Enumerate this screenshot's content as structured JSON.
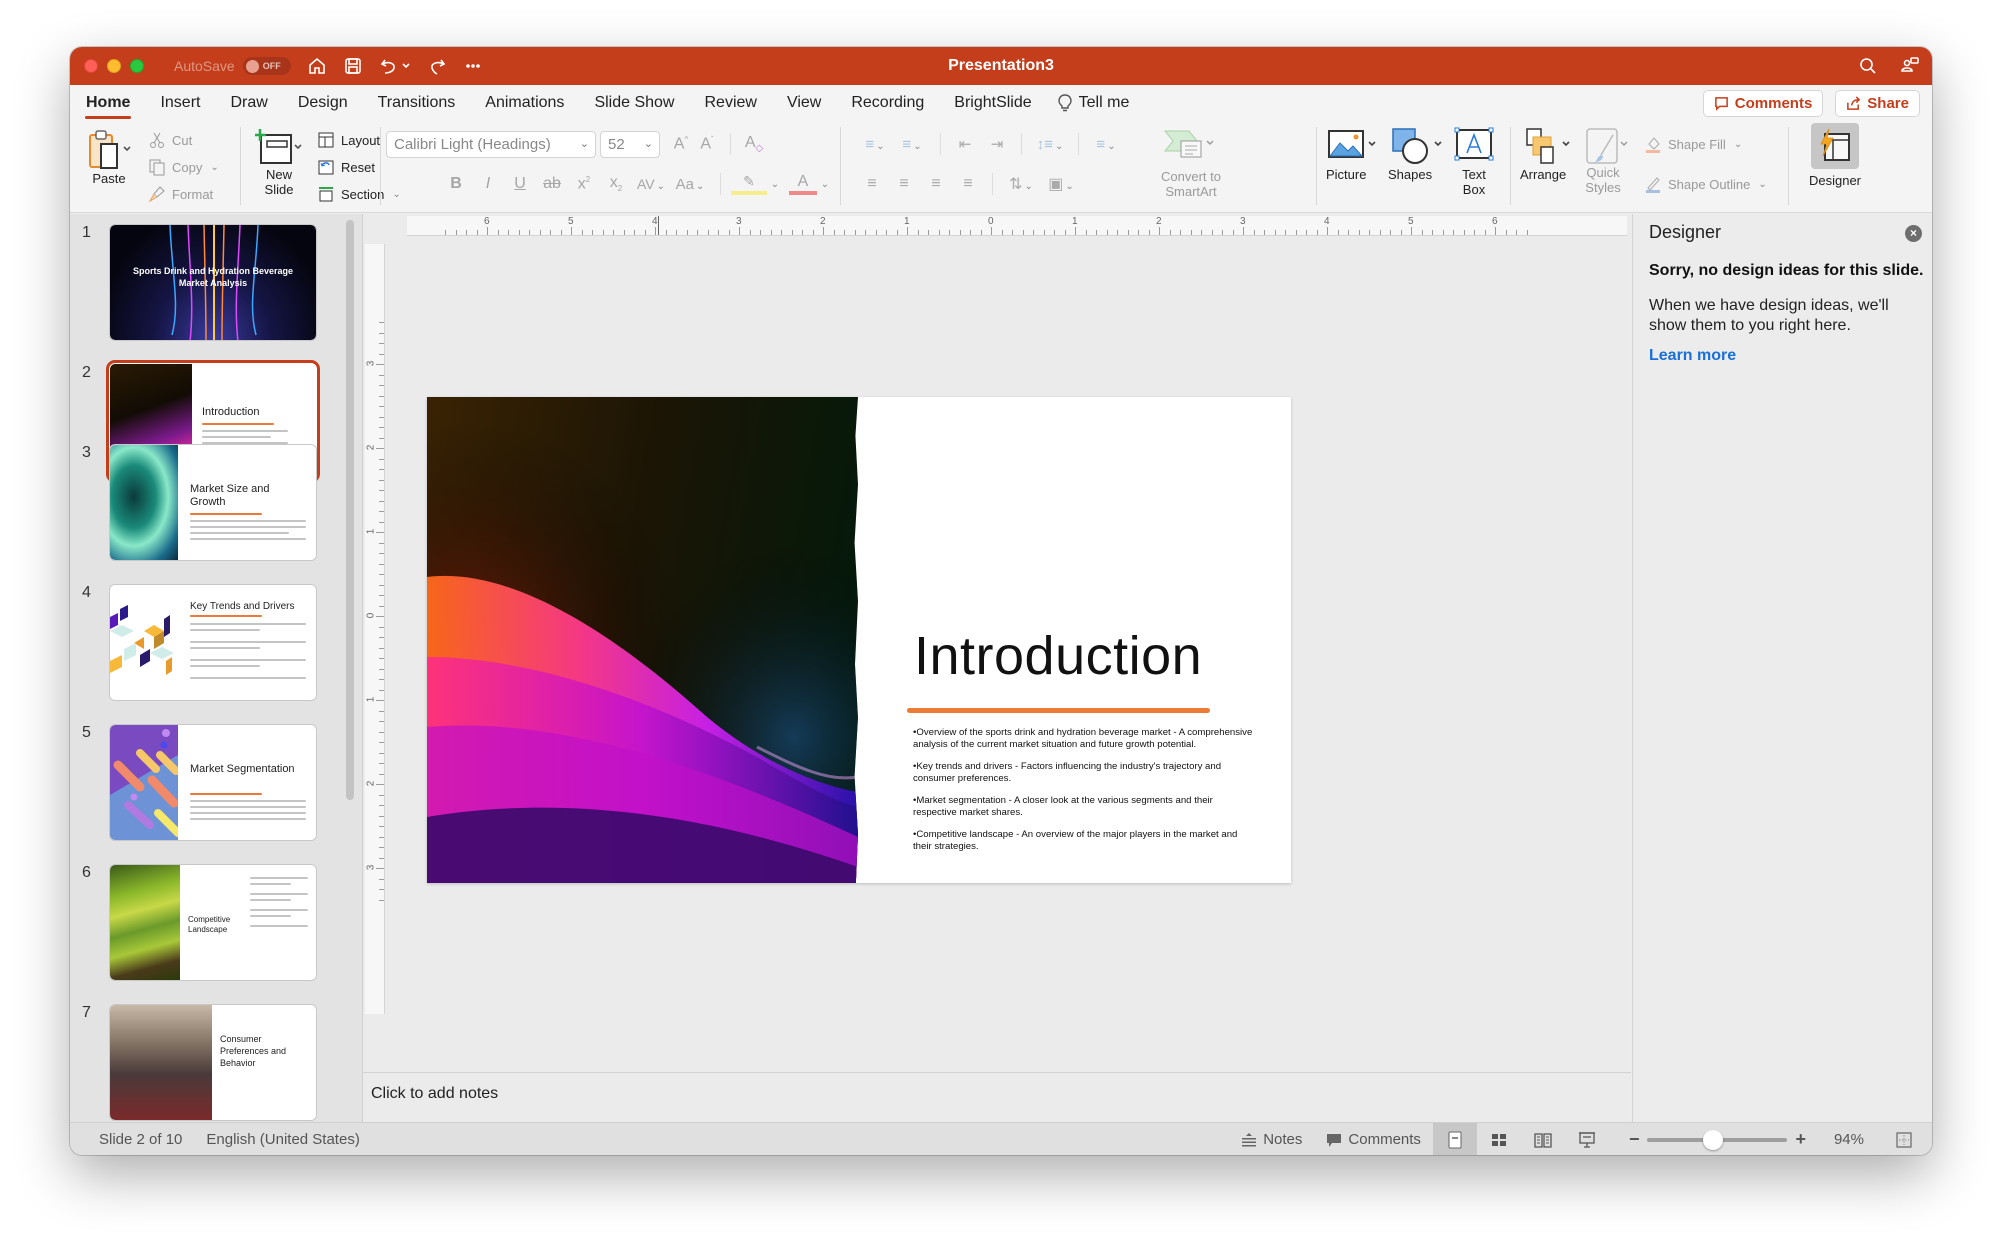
{
  "window": {
    "title": "Presentation3",
    "autosave_label": "AutoSave",
    "autosave_state": "OFF"
  },
  "tabs": [
    {
      "label": "Home",
      "active": true
    },
    {
      "label": "Insert"
    },
    {
      "label": "Draw"
    },
    {
      "label": "Design"
    },
    {
      "label": "Transitions"
    },
    {
      "label": "Animations"
    },
    {
      "label": "Slide Show"
    },
    {
      "label": "Review"
    },
    {
      "label": "View"
    },
    {
      "label": "Recording"
    },
    {
      "label": "BrightSlide"
    }
  ],
  "tell_me": "Tell me",
  "tab_actions": {
    "comments": "Comments",
    "share": "Share"
  },
  "ribbon": {
    "paste": "Paste",
    "cut": "Cut",
    "copy": "Copy",
    "format": "Format",
    "new_slide": "New Slide",
    "layout": "Layout",
    "reset": "Reset",
    "section": "Section",
    "font_name": "Calibri Light (Headings)",
    "font_size": "52",
    "convert_smartart": "Convert to SmartArt",
    "picture": "Picture",
    "shapes": "Shapes",
    "text_box": "Text Box",
    "arrange": "Arrange",
    "quick_styles": "Quick Styles",
    "shape_fill": "Shape Fill",
    "shape_outline": "Shape Outline",
    "designer": "Designer"
  },
  "ruler": {
    "horizontal": [
      "6",
      "5",
      "4",
      "3",
      "2",
      "1",
      "0",
      "1",
      "2",
      "3",
      "4",
      "5",
      "6"
    ],
    "vertical": [
      "3",
      "2",
      "1",
      "0",
      "1",
      "2",
      "3"
    ]
  },
  "thumbnails": [
    {
      "num": "1",
      "title": "Sports Drink and Hydration Beverage Market Analysis"
    },
    {
      "num": "2",
      "title": "Introduction",
      "selected": true
    },
    {
      "num": "3",
      "title": "Market Size and Growth"
    },
    {
      "num": "4",
      "title": "Key Trends and Drivers"
    },
    {
      "num": "5",
      "title": "Market Segmentation"
    },
    {
      "num": "6",
      "title": "Competitive Landscape"
    },
    {
      "num": "7",
      "title": "Consumer Preferences and Behavior"
    }
  ],
  "slide": {
    "title": "Introduction",
    "bullets": [
      "•Overview of the sports drink and hydration beverage market - A comprehensive analysis of the current market situation and future growth potential.",
      "•Key trends and drivers - Factors influencing the industry's trajectory and consumer preferences.",
      "•Market segmentation - A closer look at the various segments and their respective market shares.",
      "•Competitive landscape - An overview of the major players in the market and their strategies."
    ]
  },
  "notes_placeholder": "Click to add notes",
  "designer": {
    "title": "Designer",
    "message": "Sorry, no design ideas for this slide.",
    "description": "When we have design ideas, we'll show them to you right here.",
    "learn_more": "Learn more"
  },
  "status": {
    "slide_position": "Slide 2 of 10",
    "language": "English (United States)",
    "notes": "Notes",
    "comments": "Comments",
    "zoom_percent": "94%",
    "zoom_fraction": 0.47
  },
  "colors": {
    "accent": "#c43e1c",
    "link": "#1a6fd8",
    "underline": "#ec7b34"
  }
}
